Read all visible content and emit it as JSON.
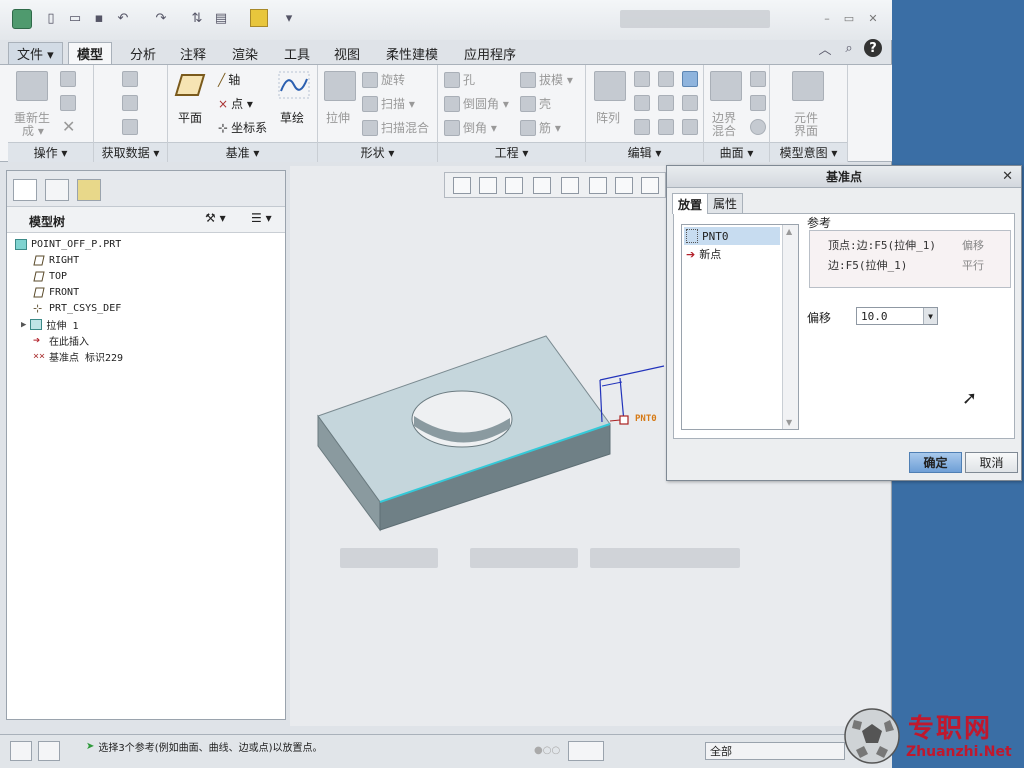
{
  "window": {
    "minimize": "–",
    "restore": "▭",
    "close": "✕"
  },
  "ribbon_tabs": [
    {
      "label": "文件 ▾"
    },
    {
      "label": "模型"
    },
    {
      "label": "分析"
    },
    {
      "label": "注释"
    },
    {
      "label": "渲染"
    },
    {
      "label": "工具"
    },
    {
      "label": "视图"
    },
    {
      "label": "柔性建模"
    },
    {
      "label": "应用程序"
    }
  ],
  "ribbon": {
    "ops": {
      "regen": "重新生",
      "regen2": "成 ▾",
      "label": "操作 ▾"
    },
    "getdata": {
      "label": "获取数据 ▾"
    },
    "datum": {
      "plane": "平面",
      "axis": "轴",
      "point": "点 ▾",
      "csys": "坐标系",
      "sketch": "草绘",
      "label": "基准 ▾"
    },
    "shapes": {
      "extrude": "拉伸",
      "revolve": "旋转",
      "sweep": "扫描 ▾",
      "swept_blend": "扫描混合",
      "label": "形状 ▾"
    },
    "eng": {
      "hole": "孔",
      "round": "倒圆角 ▾",
      "chamfer": "倒角 ▾",
      "draft": "拔模 ▾",
      "shell": "壳",
      "rib": "筋 ▾",
      "label": "工程 ▾"
    },
    "edit": {
      "pattern": "阵列",
      "label": "编辑 ▾"
    },
    "surface": {
      "boundary": "边界",
      "boundary2": "混合",
      "label": "曲面 ▾"
    },
    "intent": {
      "comp": "元件",
      "comp2": "界面",
      "label": "模型意图 ▾"
    }
  },
  "model_tree": {
    "title": "模型树",
    "items": [
      {
        "label": "POINT_OFF_P.PRT"
      },
      {
        "label": "RIGHT"
      },
      {
        "label": "TOP"
      },
      {
        "label": "FRONT"
      },
      {
        "label": "PRT_CSYS_DEF"
      },
      {
        "label": "拉伸 1"
      },
      {
        "label": "在此插入"
      },
      {
        "label": "基准点 标识229"
      }
    ]
  },
  "graphics": {
    "point_label": "PNT0"
  },
  "dialog": {
    "title": "基准点",
    "tabs": [
      {
        "label": "放置"
      },
      {
        "label": "属性"
      }
    ],
    "points": [
      {
        "label": "PNT0"
      },
      {
        "label": "新点"
      }
    ],
    "ref_label": "参考",
    "refs": [
      {
        "ref": "顶点:边:F5(拉伸_1)",
        "mode": "偏移"
      },
      {
        "ref": "边:F5(拉伸_1)",
        "mode": "平行"
      }
    ],
    "offset_label": "偏移",
    "offset_value": "10.0",
    "ok": "确定",
    "cancel": "取消"
  },
  "status": {
    "message": "选择3个参考(例如曲面、曲线、边或点)以放置点。",
    "filter": "全部"
  },
  "watermark": {
    "cn": "专职网",
    "en": "Zhuanzhi.Net"
  },
  "colors": {
    "accent": "#3a6ea5",
    "part_face": "#b9ccd3",
    "selected_edge": "#35c9d8",
    "dim_line": "#2233bb",
    "point_tag": "#d67a16"
  }
}
